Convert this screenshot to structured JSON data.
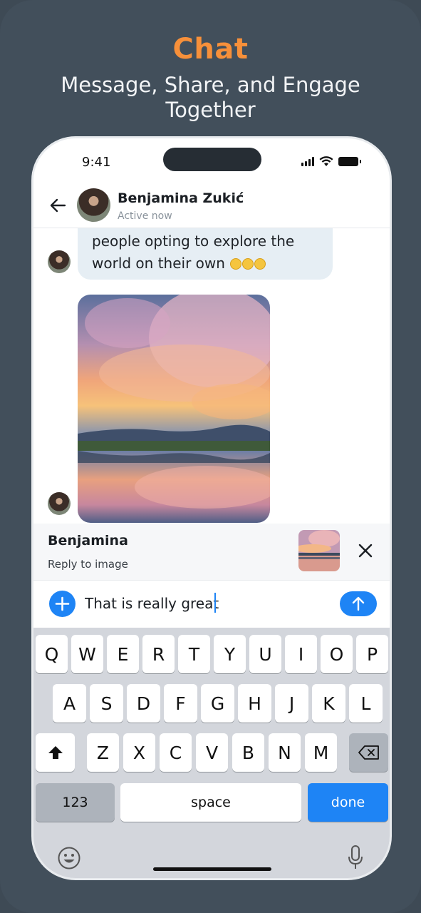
{
  "promo": {
    "title": "Chat",
    "subtitle": "Message, Share, and Engage Together"
  },
  "status_bar": {
    "time": "9:41"
  },
  "header": {
    "contact_name": "Benjamina Zukić",
    "status": "Active now"
  },
  "messages": {
    "text_line_1": "people opting to explore the",
    "text_line_2": "world on their own"
  },
  "reply": {
    "name": "Benjamina",
    "label": "Reply to image"
  },
  "composer": {
    "value": "That is really great"
  },
  "keyboard": {
    "row1": [
      "Q",
      "W",
      "E",
      "R",
      "T",
      "Y",
      "U",
      "I",
      "O",
      "P"
    ],
    "row2": [
      "A",
      "S",
      "D",
      "F",
      "G",
      "H",
      "J",
      "K",
      "L"
    ],
    "row3": [
      "Z",
      "X",
      "C",
      "V",
      "B",
      "N",
      "M"
    ],
    "numbers_label": "123",
    "space_label": "space",
    "done_label": "done"
  },
  "colors": {
    "accent": "#1e84f5",
    "title_orange": "#f7903a",
    "background": "#424f5b",
    "bubble": "#e6eef4"
  }
}
